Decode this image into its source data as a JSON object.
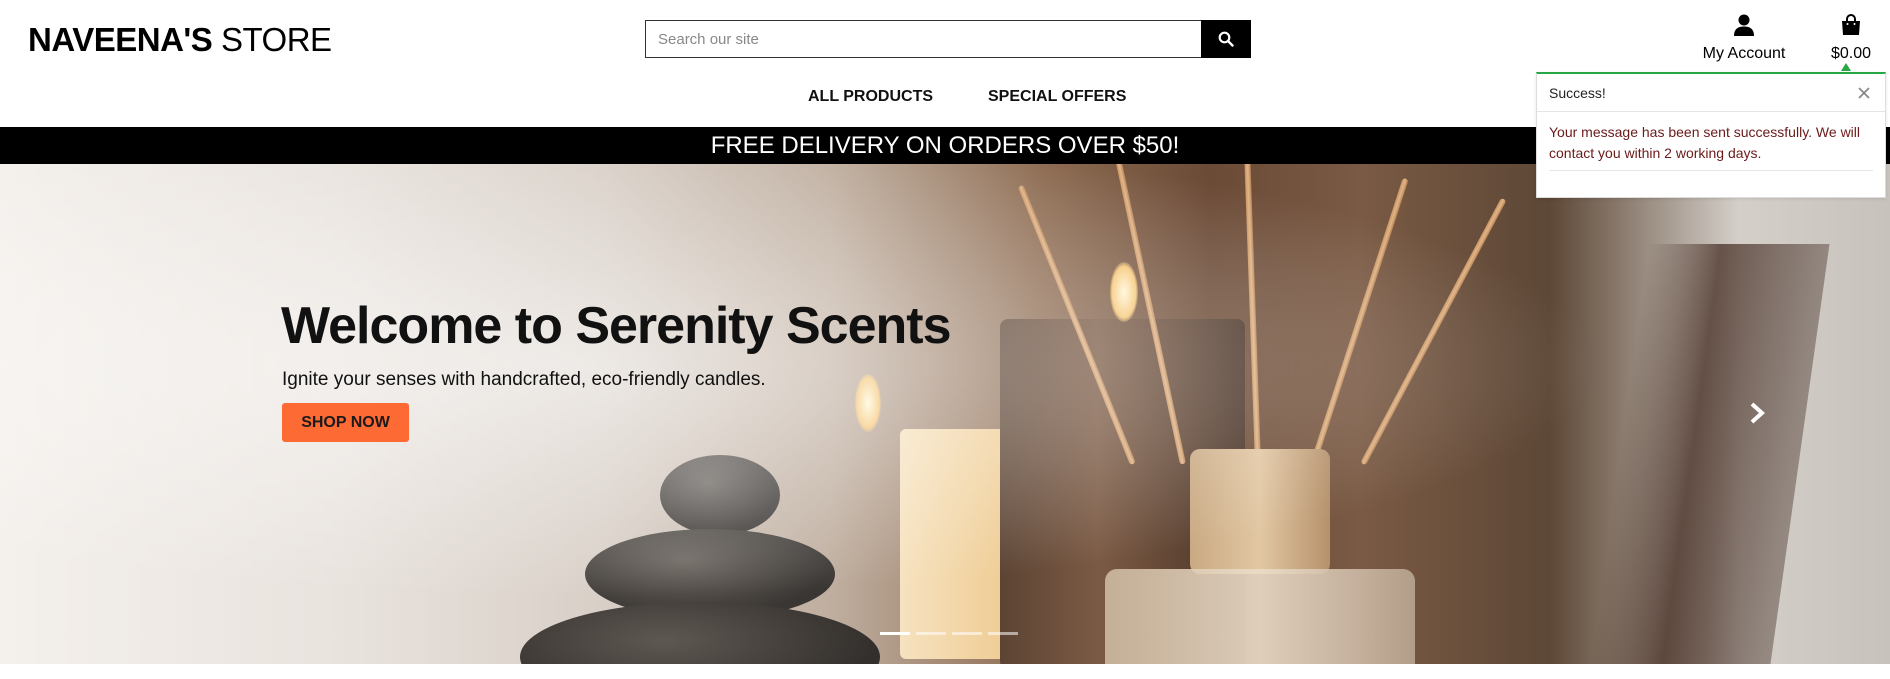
{
  "header": {
    "logo_bold": "NAVEENA'S",
    "logo_thin": "STORE",
    "search": {
      "placeholder": "Search our site",
      "value": ""
    },
    "account_label": "My Account",
    "bag_total": "$0.00"
  },
  "nav": {
    "items": [
      {
        "label": "ALL PRODUCTS"
      },
      {
        "label": "SPECIAL OFFERS"
      }
    ]
  },
  "banner": {
    "text": "FREE DELIVERY ON ORDERS OVER $50!"
  },
  "hero": {
    "title": "Welcome to Serenity Scents",
    "subtitle": "Ignite your senses with handcrafted, eco-friendly candles.",
    "cta_label": "SHOP NOW",
    "slide_count": 4,
    "active_slide": 1
  },
  "toast": {
    "title": "Success!",
    "message": "Your message has been sent successfully. We will contact you within 2 working days.",
    "accent_color": "#28a745",
    "message_color": "#6b1a1a"
  },
  "colors": {
    "cta": "#fd6a33",
    "banner_bg": "#000000"
  },
  "icons": [
    "search-icon",
    "user-icon",
    "shopping-bag-icon",
    "chevron-right-icon",
    "close-icon"
  ]
}
